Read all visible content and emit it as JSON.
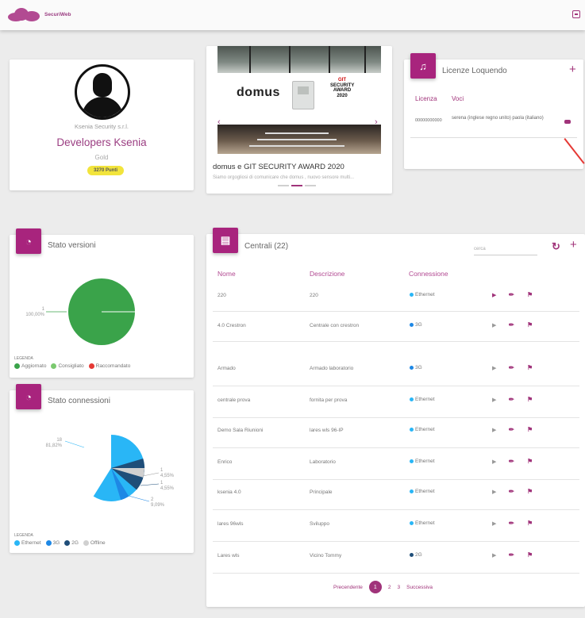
{
  "app": {
    "name": "SecuriWeb"
  },
  "profile": {
    "company": "Ksenia Security s.r.l.",
    "name": "Developers Ksenia",
    "level": "Gold",
    "points": "3270 Punti"
  },
  "news": {
    "brand": "domus",
    "award_lines": [
      "GIT",
      "SECURITY",
      "AWARD",
      "2020"
    ],
    "title": "domus e GIT SECURITY AWARD 2020",
    "subtitle": "Siamo orgogliosi di comunicare che domus , nuovo sensore multi..."
  },
  "licenses": {
    "title": "Licenze Loquendo",
    "col_license": "Licenza",
    "col_voices": "Voci",
    "rows": [
      {
        "code": "00000000000",
        "voices": "serena (inglese regno unito) paola (italiano)"
      }
    ]
  },
  "versions": {
    "title": "Stato versioni",
    "slice_label": "1",
    "slice_pct": "100,00%",
    "legend_title": "LEGENDA",
    "legend": [
      {
        "label": "Aggiornato",
        "color": "#3aa34a"
      },
      {
        "label": "Consigliato",
        "color": "#7bc96f"
      },
      {
        "label": "Raccomandato",
        "color": "#e53935"
      }
    ]
  },
  "connections": {
    "title": "Stato connessioni",
    "labels": [
      {
        "count": "18",
        "pct": "81,82%"
      },
      {
        "count": "1",
        "pct": "4,55%"
      },
      {
        "count": "1",
        "pct": "4,55%"
      },
      {
        "count": "2",
        "pct": "9,09%"
      }
    ],
    "legend_title": "LEGENDA",
    "legend": [
      {
        "label": "Ethernet",
        "color": "#29b6f6"
      },
      {
        "label": "3G",
        "color": "#1e88e5"
      },
      {
        "label": "2G",
        "color": "#1f4e79"
      },
      {
        "label": "Offline",
        "color": "#d0d0d0"
      }
    ]
  },
  "chart_data": [
    {
      "type": "pie",
      "title": "Stato versioni",
      "categories": [
        "Aggiornato",
        "Consigliato",
        "Raccomandato"
      ],
      "values": [
        1,
        0,
        0
      ],
      "colors": [
        "#3aa34a",
        "#7bc96f",
        "#e53935"
      ]
    },
    {
      "type": "pie",
      "title": "Stato connessioni",
      "categories": [
        "Ethernet",
        "3G",
        "2G",
        "Offline"
      ],
      "values": [
        18,
        2,
        1,
        1
      ],
      "colors": [
        "#29b6f6",
        "#1e88e5",
        "#1f4e79",
        "#d0d0d0"
      ]
    }
  ],
  "centrali": {
    "title": "Centrali (22)",
    "search_placeholder": "cerca",
    "headers": {
      "name": "Nome",
      "desc": "Descrizione",
      "conn": "Connessione"
    },
    "rows": [
      {
        "name": "220",
        "desc": "220",
        "conn": "Ethernet",
        "dot": "#29b6f6"
      },
      {
        "name": "4.0 Crestron",
        "desc": "Centrale con crestron",
        "conn": "3G",
        "dot": "#1e88e5"
      },
      {
        "name": "Armado",
        "desc": "Armado laboratorio",
        "conn": "3G",
        "dot": "#1e88e5"
      },
      {
        "name": "centrale prova",
        "desc": "fornita per prova",
        "conn": "Ethernet",
        "dot": "#29b6f6"
      },
      {
        "name": "Demo Sala Riunioni",
        "desc": "lares wls 96-IP",
        "conn": "Ethernet",
        "dot": "#29b6f6"
      },
      {
        "name": "Enrico",
        "desc": "Laboratorio",
        "conn": "Ethernet",
        "dot": "#29b6f6"
      },
      {
        "name": "ksenia 4.0",
        "desc": "Principale",
        "conn": "Ethernet",
        "dot": "#29b6f6"
      },
      {
        "name": "lares 96wls",
        "desc": "Sviluppo",
        "conn": "Ethernet",
        "dot": "#29b6f6"
      },
      {
        "name": "Lares wls",
        "desc": "Vicino Tommy",
        "conn": "2G",
        "dot": "#1f4e79"
      }
    ],
    "pager": {
      "prev": "Precendente",
      "current": "1",
      "p2": "2",
      "p3": "3",
      "next": "Successiva"
    }
  }
}
